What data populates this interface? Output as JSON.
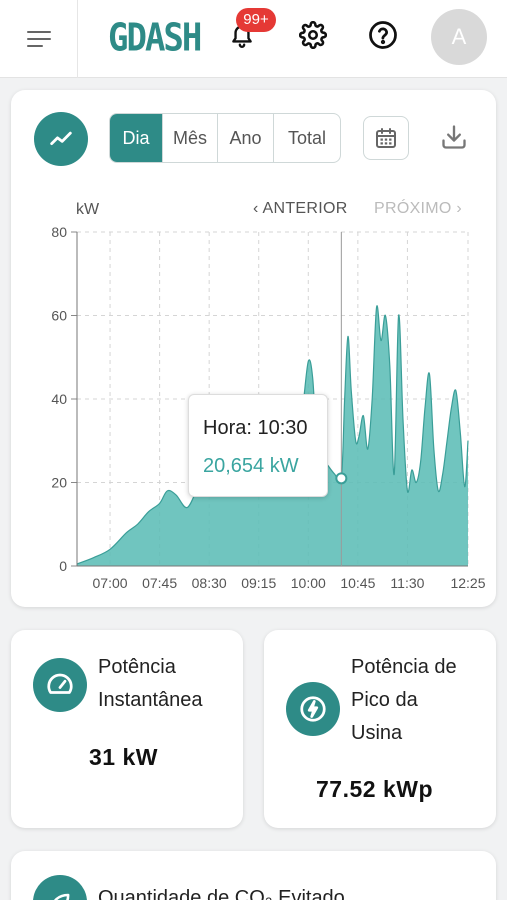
{
  "header": {
    "logo": "GDASH",
    "notification_badge": "99+",
    "avatar_initial": "A",
    "icons": [
      "menu-icon",
      "bell-icon",
      "gear-icon",
      "help-icon"
    ]
  },
  "chart_panel": {
    "tabs": [
      {
        "label": "Dia",
        "active": true
      },
      {
        "label": "Mês",
        "active": false
      },
      {
        "label": "Ano",
        "active": false
      },
      {
        "label": "Total",
        "active": false
      }
    ],
    "prev_label": "ANTERIOR",
    "next_label": "PRÓXIMO",
    "unit": "kW",
    "tooltip": {
      "label": "Hora: 10:30",
      "value": "20,654 kW"
    }
  },
  "chart_data": {
    "type": "area",
    "ylabel": "kW",
    "ylim": [
      0,
      80
    ],
    "yticks": [
      0,
      20,
      40,
      60,
      80
    ],
    "xticks": [
      "07:00",
      "07:45",
      "08:30",
      "09:15",
      "10:00",
      "10:45",
      "11:30",
      "12:25"
    ],
    "grid": true,
    "color": "#5cbdb6",
    "series": [
      {
        "x": [
          "06:30",
          "06:45",
          "07:00",
          "07:15",
          "07:25",
          "07:35",
          "07:45",
          "07:52",
          "08:00",
          "08:10",
          "08:20",
          "08:30",
          "08:40",
          "08:50",
          "09:00",
          "09:10",
          "09:20",
          "09:30",
          "09:40",
          "09:50",
          "09:55",
          "10:00",
          "10:04",
          "10:08",
          "10:12",
          "10:18",
          "10:24",
          "10:30",
          "10:33",
          "10:36",
          "10:39",
          "10:43",
          "10:46",
          "10:50",
          "10:54",
          "10:58",
          "11:02",
          "11:06",
          "11:10",
          "11:14",
          "11:18",
          "11:22",
          "11:26",
          "11:30",
          "11:34",
          "11:38",
          "11:42",
          "11:46",
          "11:50",
          "11:54",
          "11:58",
          "12:02",
          "12:06",
          "12:10",
          "12:14",
          "12:18",
          "12:22",
          "12:25"
        ],
        "y": [
          0.5,
          2,
          4,
          8,
          10,
          13,
          15,
          18,
          17,
          14,
          19,
          24,
          26,
          23,
          25,
          27,
          26,
          28,
          30,
          29,
          38,
          49,
          45,
          28,
          26,
          24,
          22,
          21,
          40,
          55,
          42,
          30,
          31,
          36,
          28,
          40,
          62,
          54,
          60,
          48,
          22,
          60,
          35,
          18,
          23,
          20,
          25,
          38,
          46,
          28,
          18,
          22,
          30,
          38,
          42,
          32,
          19,
          30
        ]
      }
    ]
  },
  "metrics": [
    {
      "icon": "gauge-icon",
      "title_lines": [
        "Potência",
        "Instantânea"
      ],
      "value": "31 kW"
    },
    {
      "icon": "bolt-icon",
      "title_lines": [
        "Potência de",
        "Pico da",
        "Usina"
      ],
      "value": "77.52 kWp"
    }
  ],
  "co2_card": {
    "title": "Quantidade de CO₂ Evitado"
  },
  "colors": {
    "brand": "#2e8b87",
    "chart_fill": "#5cbdb6",
    "badge": "#e53935"
  }
}
